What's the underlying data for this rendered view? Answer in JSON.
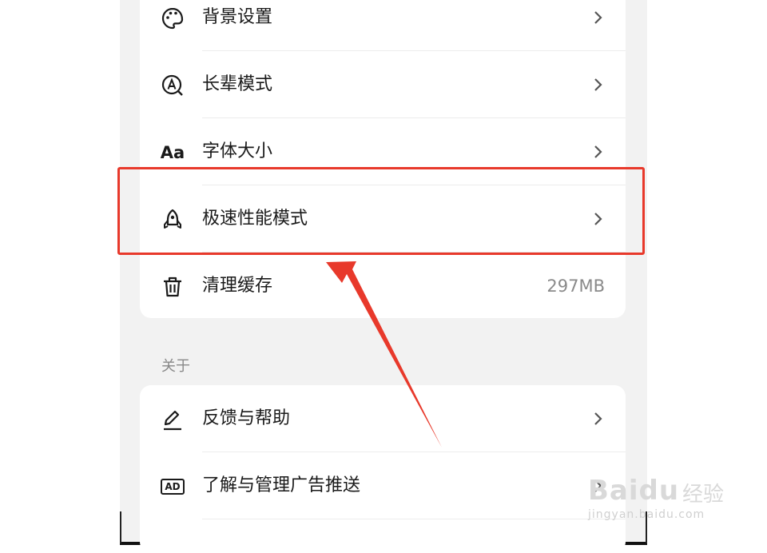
{
  "settings": {
    "items": [
      {
        "label": "背景设置",
        "icon": "palette-icon"
      },
      {
        "label": "长辈模式",
        "icon": "elder-mode-icon"
      },
      {
        "label": "字体大小",
        "icon": "font-size-icon",
        "icon_text": "Aa"
      },
      {
        "label": "极速性能模式",
        "icon": "rocket-icon"
      },
      {
        "label": "清理缓存",
        "icon": "trash-icon",
        "value": "297MB"
      }
    ]
  },
  "about": {
    "title": "关于",
    "items": [
      {
        "label": "反馈与帮助",
        "icon": "edit-icon"
      },
      {
        "label": "了解与管理广告推送",
        "icon": "ad-icon",
        "icon_text": "AD"
      }
    ]
  },
  "watermark": {
    "brand": "Baidu",
    "sub": "经验",
    "url": "jingyan.baidu.com"
  },
  "colors": {
    "highlight": "#e8392b",
    "background": "#f2f2f2",
    "card": "#ffffff",
    "secondary_text": "#8a8a8a"
  }
}
